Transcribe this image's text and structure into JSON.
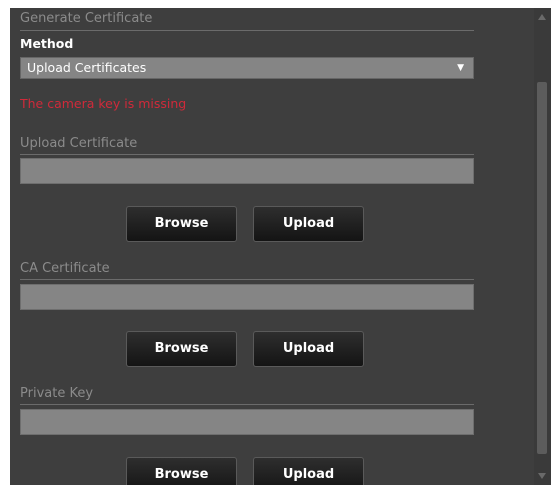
{
  "generate": {
    "title": "Generate Certificate"
  },
  "method": {
    "label": "Method",
    "selected": "Upload Certificates"
  },
  "error": "The camera key is missing",
  "sections": [
    {
      "title": "Upload Certificate",
      "value": "",
      "browse_label": "Browse",
      "upload_label": "Upload"
    },
    {
      "title": "CA Certificate",
      "value": "",
      "browse_label": "Browse",
      "upload_label": "Upload"
    },
    {
      "title": "Private Key",
      "value": "",
      "browse_label": "Browse",
      "upload_label": "Upload"
    }
  ]
}
